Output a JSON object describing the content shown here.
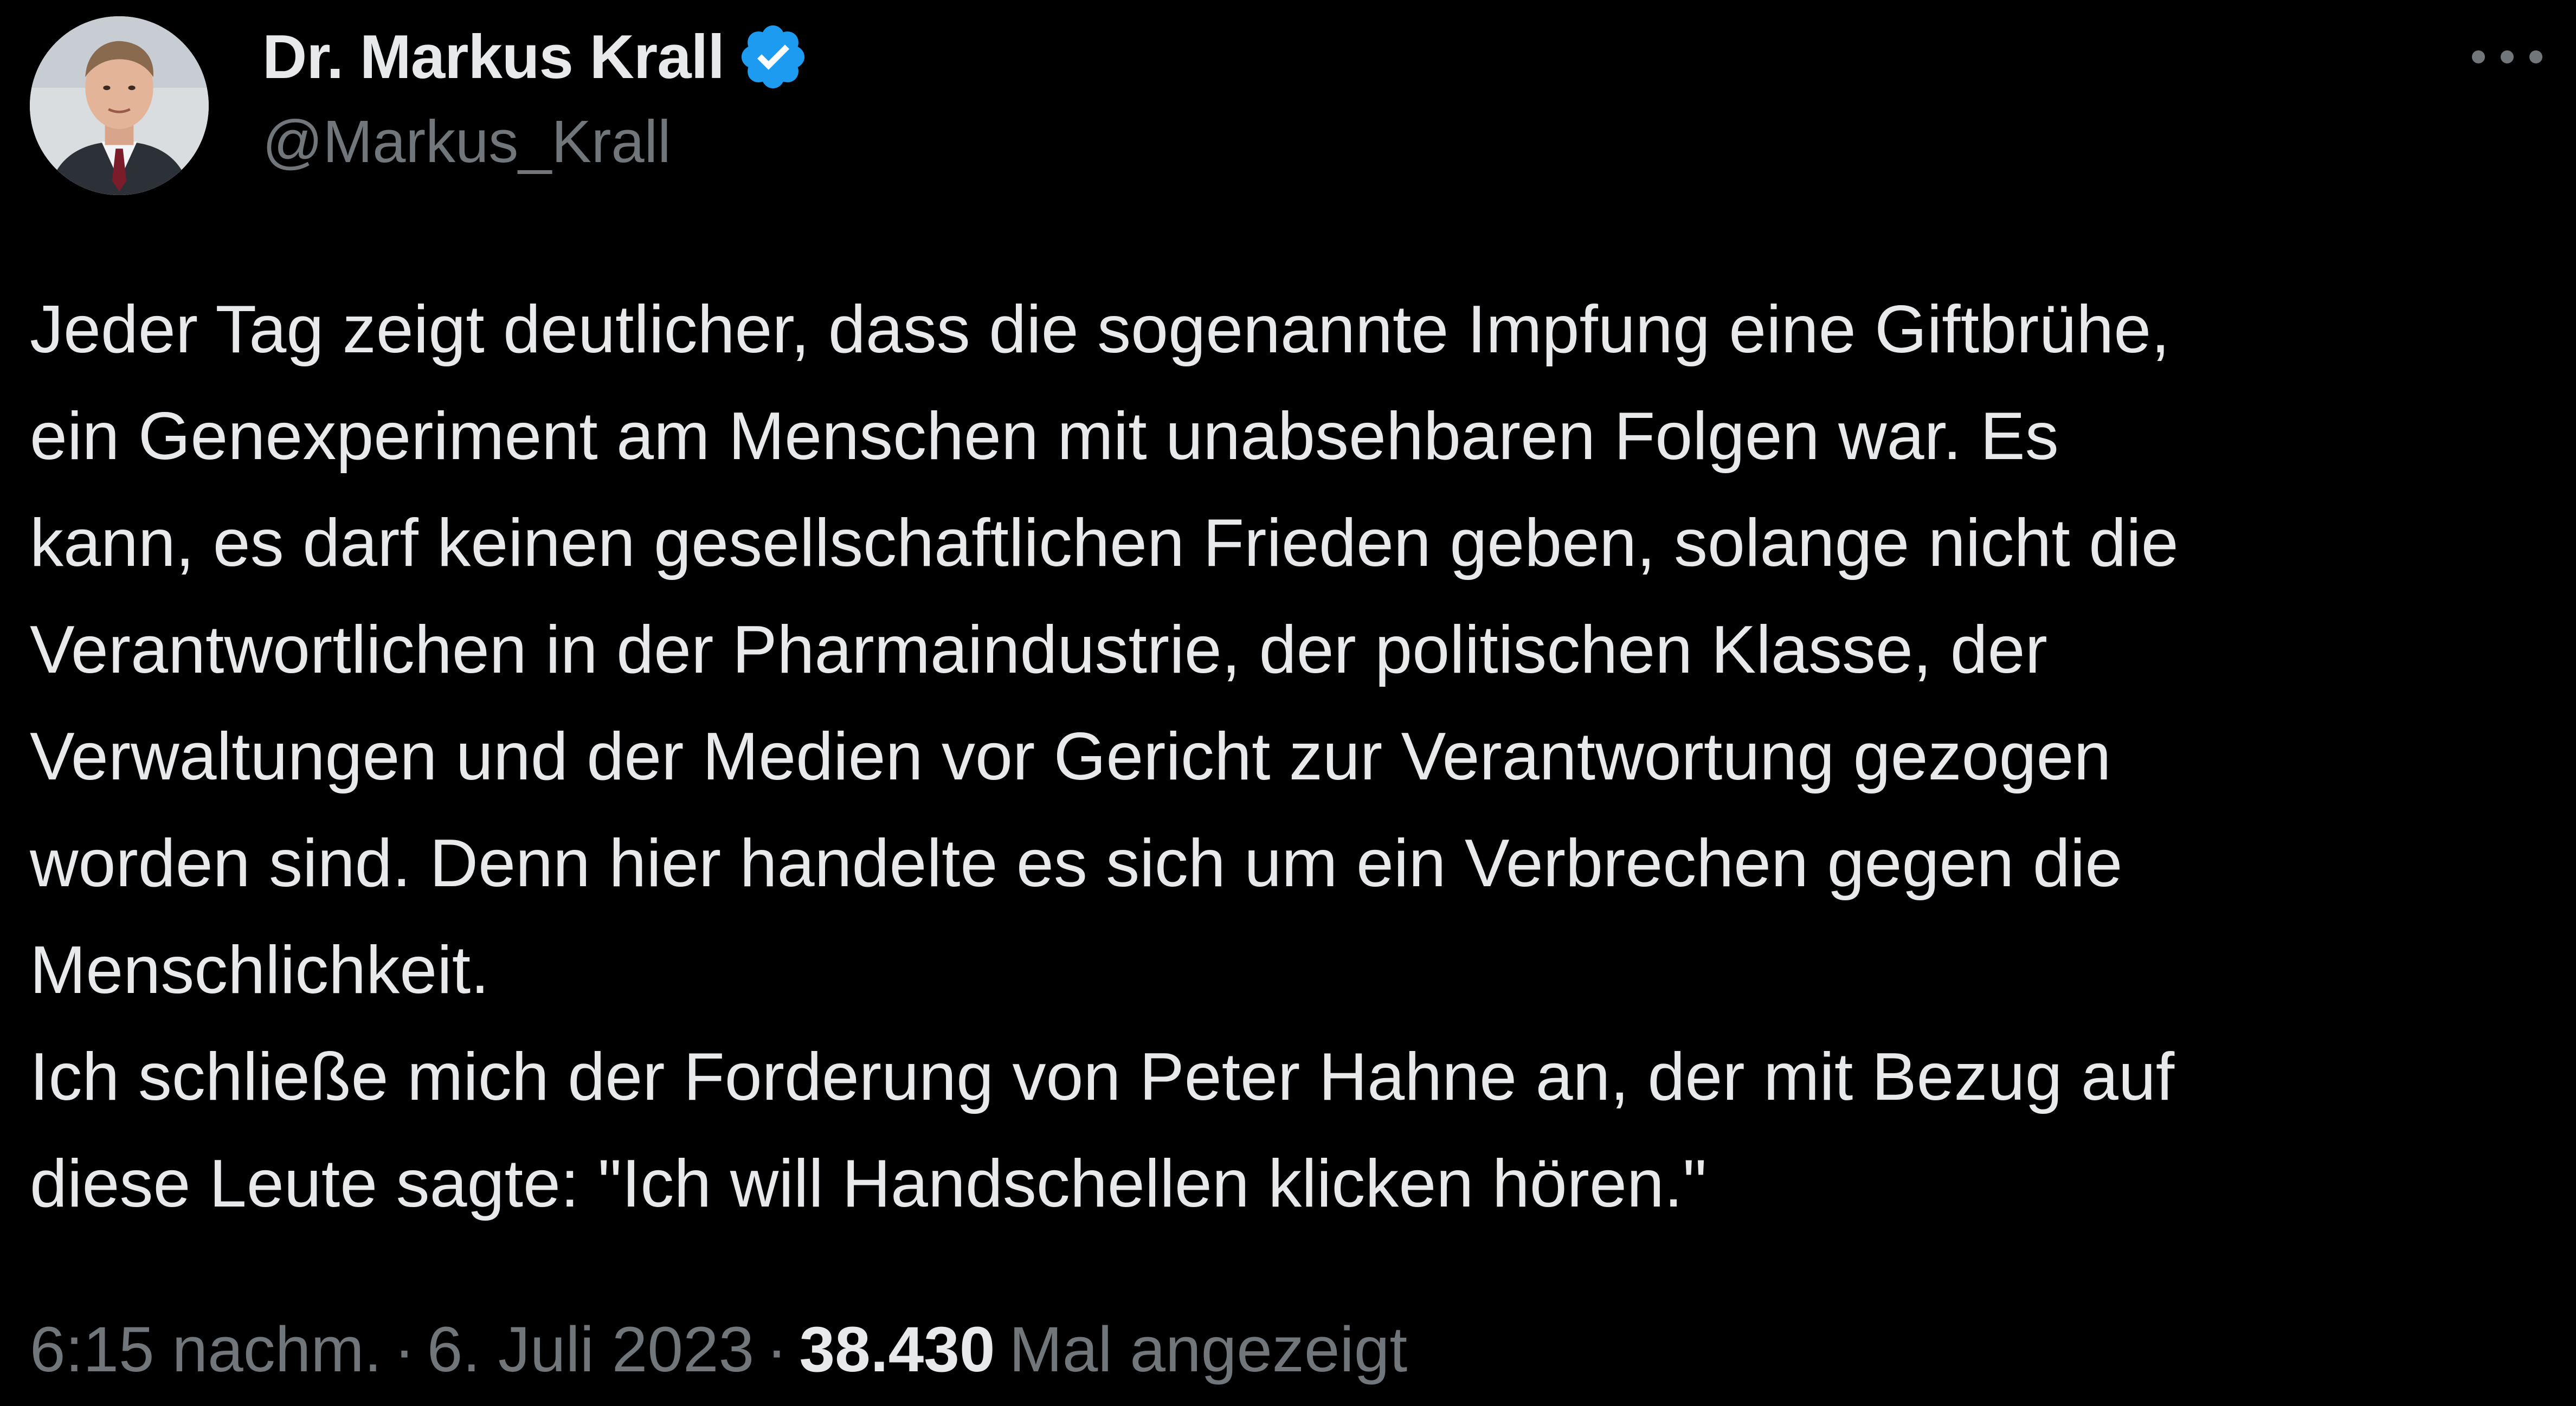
{
  "author": {
    "display_name": "Dr. Markus Krall",
    "handle": "@Markus_Krall",
    "verified": true,
    "avatar_icon": "profile-photo",
    "verified_icon": "verified-badge-icon"
  },
  "menu": {
    "icon": "more-options-icon"
  },
  "tweet": {
    "lines": [
      "Jeder Tag zeigt deutlicher, dass die sogenannte Impfung eine Giftbrühe,",
      "ein Genexperiment am Menschen mit unabsehbaren Folgen war. Es",
      "kann, es darf keinen gesellschaftlichen Frieden geben, solange nicht die",
      "Verantwortlichen in der Pharmaindustrie, der politischen Klasse, der",
      "Verwaltungen und der Medien vor Gericht zur Verantwortung gezogen",
      "worden sind. Denn hier handelte es sich um ein Verbrechen gegen die",
      "Menschlichkeit.",
      "Ich schließe mich der Forderung von Peter Hahne an, der mit Bezug auf",
      "diese Leute sagte: \"Ich will Handschellen klicken hören.\""
    ]
  },
  "meta": {
    "time": "6:15 nachm.",
    "separator": "·",
    "date": "6. Juli 2023",
    "views_count": "38.430",
    "views_label": "Mal angezeigt"
  },
  "colors": {
    "background": "#000000",
    "primary_text": "#e7e9ea",
    "secondary_text": "#71767b",
    "verified_blue": "#1d9bf0"
  }
}
